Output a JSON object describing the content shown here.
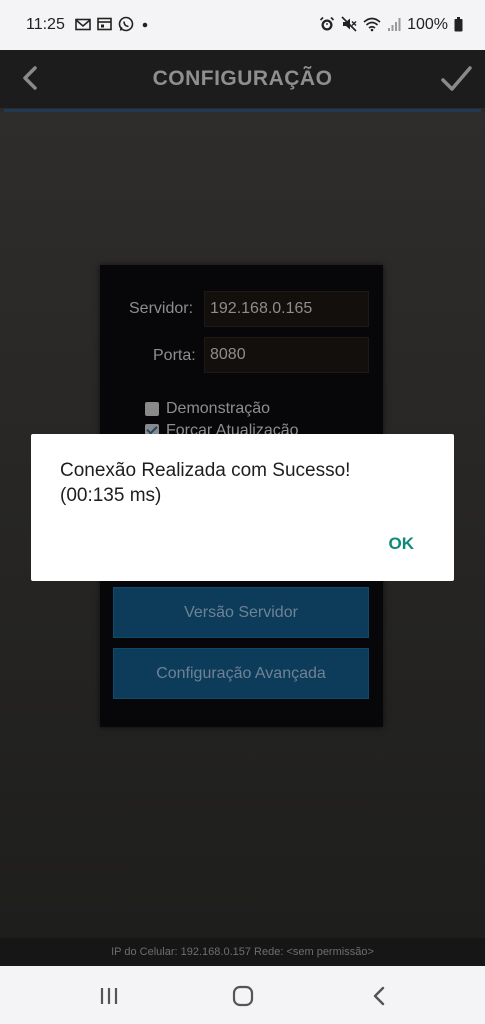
{
  "status_bar": {
    "time": "11:25",
    "left_icons": [
      "gmail-icon",
      "calendar-icon",
      "whatsapp-icon",
      "dot-icon"
    ],
    "right_icons": [
      "alarm-icon",
      "mute-icon",
      "wifi-icon",
      "signal-icon",
      "battery-icon"
    ],
    "battery": "100%"
  },
  "header": {
    "title": "CONFIGURAÇÃO",
    "back_icon": "chevron-left-icon",
    "confirm_icon": "check-icon"
  },
  "form": {
    "server_label": "Servidor:",
    "server_value": "192.168.0.165",
    "port_label": "Porta:",
    "port_value": "8080",
    "demo_label": "Demonstração",
    "demo_checked": false,
    "force_update_label": "Forçar Atualização",
    "force_update_checked": true,
    "server_version_button": "Versão Servidor",
    "advanced_config_button": "Configuração Avançada"
  },
  "footer": {
    "ip_info": "IP do Celular: 192.168.0.157  Rede: <sem permissão>"
  },
  "dialog": {
    "message_line1": "Conexão Realizada com Sucesso!",
    "message_line2": "(00:135 ms)",
    "ok_label": "OK"
  },
  "navbar": {
    "recents_icon": "recents-icon",
    "home_icon": "home-icon",
    "back_icon": "back-icon"
  }
}
